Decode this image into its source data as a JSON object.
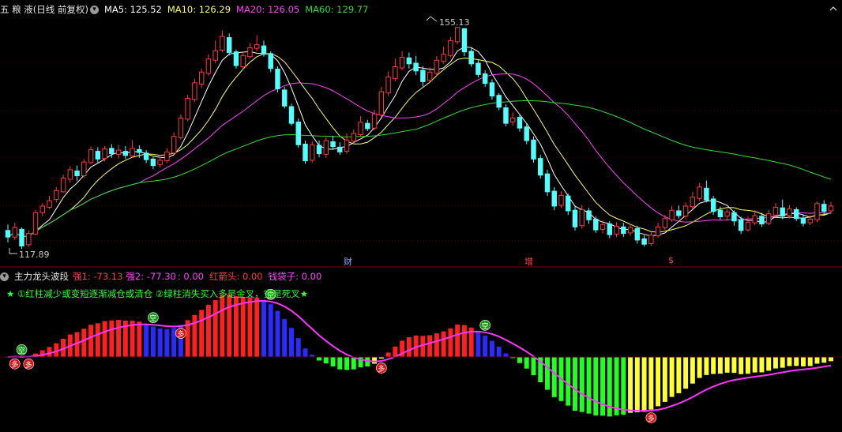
{
  "main_panel": {
    "title": "五 粮 液(日线 前复权)",
    "ma5": "MA5: 125.52",
    "ma10": "MA10: 126.29",
    "ma20": "MA20: 126.05",
    "ma60": "MA60: 129.77",
    "high_label": "155.13",
    "low_label": "117.89",
    "event_markers": [
      "财",
      "增",
      "$"
    ],
    "colors": {
      "up": "#ff3b3b",
      "down": "#54ffff",
      "ma5": "#ffffff",
      "ma10": "#ffff66",
      "ma20": "#ff44ff",
      "ma60": "#33dd33"
    }
  },
  "sub_panel": {
    "title": "主力龙头波段",
    "qiang1": "强1: -73.13",
    "qiang2": "强2: -77.30",
    "sep": ": 0.00",
    "red_arrow": "红箭头: 0.00",
    "money_bag": "钱袋子: 0.00",
    "note": "★ ①红柱减少或变短逐渐减仓或清仓 ②绿柱消失买入多是金叉，空是死叉★",
    "marker_kong": "空",
    "marker_duo": "多",
    "marker_bag": "$",
    "colors": {
      "red": "#ff2020",
      "blue": "#2b2bff",
      "yellow": "#ffff33",
      "green": "#22ff22",
      "line": "#ff33ff"
    }
  },
  "chart_data": {
    "type": "candlestick",
    "series_note": "OHLC daily, with MA5/MA10/MA20/MA60",
    "price_range_visible": [
      117.89,
      155.13
    ],
    "ohlc": [
      [
        121.0,
        119.9,
        122.0,
        119.0
      ],
      [
        119.9,
        121.5,
        122.3,
        119.4
      ],
      [
        121.2,
        118.4,
        121.5,
        117.9
      ],
      [
        118.6,
        120.5,
        121.0,
        118.2
      ],
      [
        120.4,
        124.0,
        124.4,
        120.2
      ],
      [
        124.0,
        125.1,
        125.6,
        123.4
      ],
      [
        124.9,
        126.0,
        126.8,
        124.6
      ],
      [
        126.2,
        127.7,
        128.3,
        125.7
      ],
      [
        127.5,
        129.8,
        130.4,
        127.3
      ],
      [
        129.6,
        131.2,
        131.8,
        129.0
      ],
      [
        131.0,
        130.2,
        131.9,
        129.3
      ],
      [
        130.2,
        132.5,
        133.0,
        129.8
      ],
      [
        132.4,
        134.6,
        135.1,
        132.1
      ],
      [
        134.3,
        133.0,
        135.0,
        132.4
      ],
      [
        133.1,
        134.7,
        135.2,
        132.6
      ],
      [
        134.8,
        133.9,
        135.5,
        133.2
      ],
      [
        133.8,
        134.5,
        135.4,
        133.1
      ],
      [
        134.3,
        133.6,
        135.2,
        133.0
      ],
      [
        133.5,
        134.8,
        136.2,
        133.2
      ],
      [
        134.6,
        134.1,
        135.3,
        133.2
      ],
      [
        134.0,
        132.9,
        134.5,
        132.3
      ],
      [
        133.0,
        131.9,
        133.3,
        131.3
      ],
      [
        132.1,
        132.8,
        133.4,
        131.6
      ],
      [
        132.7,
        134.2,
        134.8,
        132.3
      ],
      [
        134.0,
        136.8,
        137.5,
        133.8
      ],
      [
        136.6,
        139.9,
        140.5,
        136.3
      ],
      [
        139.7,
        143.2,
        143.8,
        139.3
      ],
      [
        143.0,
        145.8,
        146.5,
        142.6
      ],
      [
        145.6,
        147.6,
        148.2,
        144.9
      ],
      [
        147.4,
        149.8,
        150.6,
        147.0
      ],
      [
        149.6,
        151.2,
        152.9,
        149.1
      ],
      [
        151.3,
        153.6,
        154.6,
        150.9
      ],
      [
        153.4,
        150.9,
        154.1,
        150.4
      ],
      [
        151.0,
        148.7,
        151.4,
        148.2
      ],
      [
        148.5,
        150.4,
        151.0,
        148.0
      ],
      [
        150.2,
        151.7,
        152.5,
        149.9
      ],
      [
        151.6,
        152.2,
        153.8,
        151.1
      ],
      [
        152.0,
        150.6,
        152.9,
        150.2
      ],
      [
        150.7,
        148.2,
        151.1,
        147.6
      ],
      [
        148.1,
        144.8,
        148.6,
        144.2
      ],
      [
        144.6,
        141.9,
        145.1,
        141.5
      ],
      [
        141.8,
        139.0,
        142.3,
        138.6
      ],
      [
        139.2,
        135.4,
        139.8,
        134.9
      ],
      [
        135.5,
        132.7,
        136.1,
        132.2
      ],
      [
        132.8,
        135.4,
        136.0,
        132.4
      ],
      [
        135.3,
        133.9,
        136.1,
        133.3
      ],
      [
        133.8,
        136.1,
        136.7,
        133.2
      ],
      [
        135.9,
        135.1,
        136.9,
        134.6
      ],
      [
        135.0,
        134.2,
        135.8,
        133.7
      ],
      [
        134.3,
        136.2,
        137.3,
        133.9
      ],
      [
        136.0,
        137.3,
        138.0,
        135.6
      ],
      [
        137.1,
        139.2,
        140.2,
        136.8
      ],
      [
        139.0,
        138.1,
        139.6,
        137.7
      ],
      [
        138.2,
        140.6,
        141.3,
        137.9
      ],
      [
        140.4,
        144.3,
        145.1,
        140.0
      ],
      [
        144.1,
        146.8,
        147.7,
        143.6
      ],
      [
        146.5,
        148.5,
        149.9,
        146.1
      ],
      [
        148.3,
        150.1,
        151.1,
        147.9
      ],
      [
        150.0,
        149.0,
        150.9,
        148.2
      ],
      [
        149.1,
        147.8,
        150.3,
        147.1
      ],
      [
        147.9,
        146.0,
        148.6,
        145.2
      ],
      [
        146.2,
        147.6,
        148.4,
        145.9
      ],
      [
        147.4,
        149.6,
        150.3,
        147.0
      ],
      [
        149.4,
        150.6,
        151.9,
        149.0
      ],
      [
        150.4,
        152.9,
        153.5,
        150.1
      ],
      [
        152.7,
        155.1,
        155.2,
        152.3
      ],
      [
        154.9,
        151.0,
        155.0,
        150.3
      ],
      [
        151.1,
        149.0,
        151.7,
        148.5
      ],
      [
        149.1,
        147.2,
        149.8,
        146.7
      ],
      [
        147.3,
        145.7,
        147.9,
        145.1
      ],
      [
        145.8,
        143.6,
        146.4,
        143.0
      ],
      [
        143.7,
        141.7,
        144.1,
        141.2
      ],
      [
        141.6,
        139.0,
        142.2,
        138.5
      ],
      [
        139.2,
        139.9,
        140.8,
        138.6
      ],
      [
        140.0,
        138.2,
        140.6,
        137.6
      ],
      [
        138.4,
        136.1,
        138.9,
        135.5
      ],
      [
        136.2,
        133.0,
        136.8,
        132.4
      ],
      [
        133.1,
        130.3,
        133.7,
        129.7
      ],
      [
        130.5,
        127.5,
        131.2,
        126.8
      ],
      [
        127.6,
        125.1,
        128.3,
        124.4
      ],
      [
        125.2,
        126.9,
        127.6,
        124.8
      ],
      [
        126.8,
        124.3,
        127.2,
        123.6
      ],
      [
        124.4,
        121.6,
        125.0,
        121.0
      ],
      [
        121.8,
        124.5,
        125.3,
        121.3
      ],
      [
        124.3,
        122.8,
        124.8,
        122.1
      ],
      [
        122.9,
        121.1,
        123.4,
        120.6
      ],
      [
        121.2,
        122.0,
        122.7,
        120.5
      ],
      [
        122.1,
        120.3,
        122.6,
        119.7
      ],
      [
        120.4,
        121.7,
        122.4,
        119.9
      ],
      [
        121.6,
        120.5,
        122.3,
        119.9
      ],
      [
        120.6,
        121.5,
        122.1,
        120.1
      ],
      [
        121.3,
        119.4,
        121.8,
        118.8
      ],
      [
        119.6,
        118.7,
        120.2,
        118.3
      ],
      [
        118.8,
        120.2,
        120.7,
        118.4
      ],
      [
        120.1,
        121.6,
        122.3,
        119.8
      ],
      [
        121.5,
        123.0,
        123.6,
        121.1
      ],
      [
        122.8,
        124.4,
        125.1,
        122.4
      ],
      [
        124.3,
        123.5,
        125.2,
        123.0
      ],
      [
        123.4,
        125.1,
        125.7,
        123.0
      ],
      [
        125.0,
        126.6,
        127.5,
        124.6
      ],
      [
        126.4,
        128.3,
        129.0,
        126.0
      ],
      [
        128.1,
        126.1,
        129.4,
        125.7
      ],
      [
        126.3,
        124.2,
        126.8,
        123.6
      ],
      [
        124.4,
        123.3,
        125.0,
        122.8
      ],
      [
        123.4,
        124.1,
        124.6,
        122.6
      ],
      [
        124.0,
        122.6,
        124.4,
        121.8
      ],
      [
        122.8,
        121.0,
        123.3,
        120.4
      ],
      [
        121.1,
        122.4,
        123.4,
        120.8
      ],
      [
        122.3,
        123.5,
        124.4,
        121.9
      ],
      [
        123.4,
        122.1,
        124.0,
        121.6
      ],
      [
        122.2,
        123.8,
        124.5,
        121.9
      ],
      [
        123.6,
        124.9,
        125.6,
        123.3
      ],
      [
        124.8,
        123.4,
        126.2,
        122.9
      ],
      [
        123.5,
        124.6,
        125.3,
        123.0
      ],
      [
        124.5,
        123.0,
        124.9,
        122.6
      ],
      [
        123.1,
        122.2,
        123.6,
        121.7
      ],
      [
        122.3,
        122.9,
        123.5,
        121.9
      ],
      [
        122.8,
        125.52,
        125.9,
        122.4
      ],
      [
        125.4,
        124.2,
        126.1,
        123.7
      ],
      [
        124.3,
        125.1,
        125.8,
        123.8
      ]
    ]
  }
}
